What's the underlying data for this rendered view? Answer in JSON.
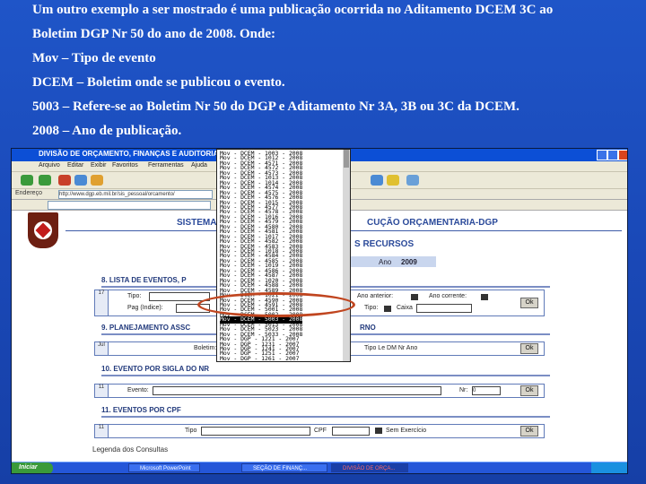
{
  "slide": {
    "lines": [
      "Um outro exemplo a ser mostrado é uma publicação ocorrida no Aditamento DCEM 3C ao",
      "Boletim DGP Nr 50 do ano de 2008. Onde:",
      "Mov – Tipo de evento",
      "DCEM – Boletim onde se publicou o evento.",
      "5003 – Refere-se ao Boletim Nr 50 do DGP e Aditamento Nr 3A, 3B ou 3C da DCEM.",
      "2008 – Ano de publicação."
    ]
  },
  "window": {
    "title": "DIVISÃO DE ORÇAMENTO, FINANÇAS E AUDITORIA",
    "menu": [
      "Arquivo",
      "Editar",
      "Exibir",
      "Favoritos",
      "Ferramentas",
      "Ajuda"
    ],
    "address_label": "Endereço",
    "address_value": "http://www.dgp.eb.mil.br/sis_pessoal/orcamento/"
  },
  "page": {
    "system_title_left": "SISTEMA",
    "system_title_right": "CUÇÃO ORÇAMENTARIA-DGP",
    "subtitle": "S RECURSOS",
    "year_label": "Ano",
    "year_value": "2009",
    "sections": {
      "s8": "8. LISTA DE EVENTOS, P",
      "s9": "9. PLANEJAMENTO ASSC",
      "s9_right": "RNO",
      "s10": "10. EVENTO POR SIGLA DO NR",
      "s11": "11. EVENTOS POR CPF"
    },
    "s8_fields": {
      "tipo": "Tipo:",
      "pag": "Pag (Indice):",
      "ano_anterior": "Ano anterior:",
      "ano_corrente": "Ano corrente:",
      "tipo2": "Tipo:",
      "caixa": "Caixa",
      "side": "17"
    },
    "s9_fields": {
      "boletim": "Boletim:",
      "tipo_le": "Tipo Le  DM  Nr  Ano",
      "side": "Jul"
    },
    "s10_fields": {
      "evento": "Evento:",
      "nr": "Nr:",
      "nr_value": "0",
      "side": "11"
    },
    "s11_fields": {
      "tipo": "Tipo",
      "cpf": "CPF",
      "sem_exercicio": "Sem Exercício",
      "side": "11"
    },
    "ok": "Ok",
    "legend": "Legenda dos Consultas"
  },
  "dropdown": {
    "items": [
      "Mov - DCEM - 1003 - 2008",
      "Mov - DCEM - 1012 - 2008",
      "Mov - DCEM - 4571 - 2008",
      "Mov - DCEM - 4572 - 2008",
      "Mov - DCEM - 4573 - 2008",
      "Mov - DCEM - 1013 - 2008",
      "Mov - DCEM - 1014 - 2008",
      "Mov - DCEM - 4574 - 2008",
      "Mov - DCEM - 4575 - 2008",
      "Mov - DCEM - 4576 - 2008",
      "Mov - DCEM - 1015 - 2008",
      "Mov - DCEM - 4577 - 2008",
      "Mov - DCEM - 4578 - 2008",
      "Mov - DCEM - 1016 - 2008",
      "Mov - DCEM - 4579 - 2008",
      "Mov - DCEM - 4580 - 2008",
      "Mov - DCEM - 4581 - 2008",
      "Mov - DCEM - 1017 - 2008",
      "Mov - DCEM - 4582 - 2008",
      "Mov - DCEM - 4583 - 2008",
      "Mov - DCEM - 1018 - 2008",
      "Mov - DCEM - 4584 - 2008",
      "Mov - DCEM - 4585 - 2008",
      "Mov - DCEM - 1019 - 2008",
      "Mov - DCEM - 4586 - 2008",
      "Mov - DCEM - 4587 - 2008",
      "Mov - DCEM - 1020 - 2008",
      "Mov - DCEM - 4588 - 2008",
      "Mov - DCEM - 4589 - 2008",
      "Mov - DCEM - 1021 - 2008",
      "Mov - DCEM - 4590 - 2008",
      "Mov - DCEM - 4591 - 2008",
      "Mov - DCEM - 5001 - 2008",
      "Mov - DCEM - 5002 - 2008",
      "Mov - DCEM - 5003 - 2008",
      "Mov - DCEM - 5013 - 2008",
      "Mov - DCEM - 5023 - 2008",
      "Mov - DCEM - 5033 - 2008",
      "Mov - DGP - 1221 - 2007",
      "Mov - DGP - 1231 - 2007",
      "Mov - DGP - 1241 - 2007",
      "Mov - DGP - 1251 - 2007",
      "Mov - DGP - 1261 - 2007"
    ],
    "selected_index": 34
  },
  "taskbar": {
    "start": "Iniciar",
    "tasks": [
      "Microsoft PowerPoint",
      "SEÇÃO DE FINANÇ...",
      "DIVISÃO DE ORÇA..."
    ]
  },
  "colors": {
    "slide_bg": "#1f55c8",
    "highlight_oval": "#c0451f",
    "page_title": "#2b4a9a"
  }
}
